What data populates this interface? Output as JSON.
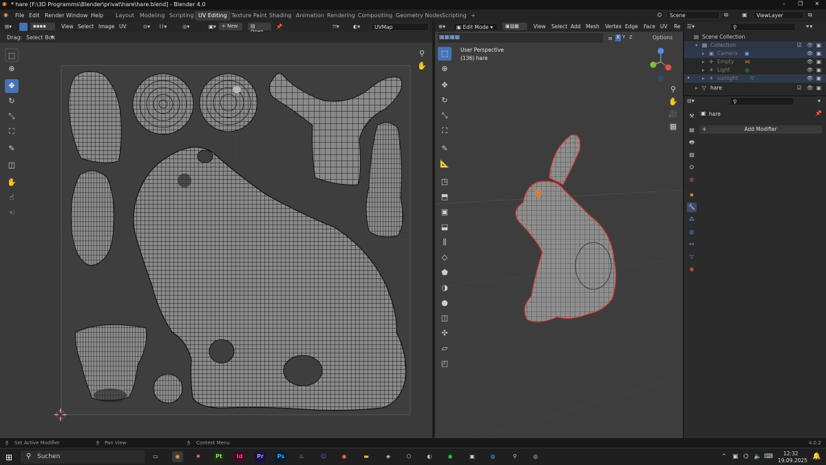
{
  "title": "* hare [F:\\3D Programms\\Blender\\privat\\hare\\hare.blend] - Blender 4.0",
  "menus": [
    "File",
    "Edit",
    "Render",
    "Window",
    "Help"
  ],
  "workspaces": [
    "Layout",
    "Modeling",
    "Scripting",
    "UV Editing",
    "Texture Paint",
    "Shading",
    "Animation",
    "Rendering",
    "Compositing",
    "Geometry Nodes",
    "Scripting",
    "+"
  ],
  "active_workspace": "UV Editing",
  "scene": "Scene",
  "view_layer": "ViewLayer",
  "uv_editor": {
    "menu": [
      "View",
      "Select",
      "Image",
      "UV"
    ],
    "new_label": "New",
    "open_label": "Open",
    "uv_map": "UVMap",
    "drag_label": "Drag:",
    "select_box": "Select Box"
  },
  "viewport": {
    "mode": "Edit Mode",
    "menu": [
      "View",
      "Select",
      "Add",
      "Mesh",
      "Vertex",
      "Edge",
      "Face",
      "UV",
      "Re"
    ],
    "overlay_title": "User Perspective",
    "overlay_obj": "(136) hare",
    "options": "Options",
    "axes": [
      "X",
      "Y",
      "Z"
    ]
  },
  "outliner": {
    "rows": [
      {
        "label": "Scene Collection"
      },
      {
        "label": "Collection"
      },
      {
        "label": "Camera"
      },
      {
        "label": "Empty"
      },
      {
        "label": "Light"
      },
      {
        "label": "sunlight"
      },
      {
        "label": "hare"
      }
    ]
  },
  "properties": {
    "object": "hare",
    "add_modifier": "Add Modifier"
  },
  "status": {
    "left": "Set Active Modifier",
    "mid": "Pan View",
    "right": "Context Menu",
    "version": "4.0.2"
  },
  "taskbar": {
    "search": "Suchen",
    "time": "12:32",
    "date": "19.09.2025"
  },
  "colors": {
    "accent": "#4772b3",
    "select": "#e03030",
    "orange": "#e08a2a"
  }
}
